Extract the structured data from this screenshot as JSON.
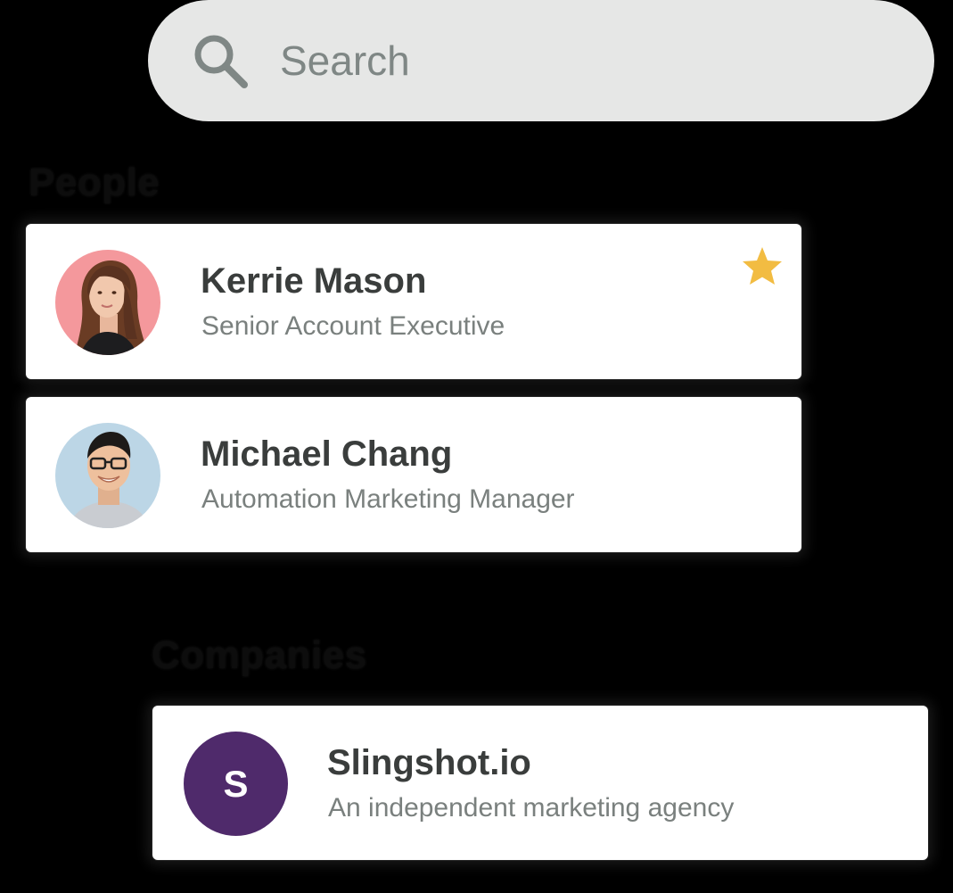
{
  "search": {
    "placeholder": "Search",
    "icon": "search-icon"
  },
  "sections": {
    "people_heading": "People",
    "companies_heading": "Companies"
  },
  "people": [
    {
      "name": "Kerrie Mason",
      "title": "Senior Account Executive",
      "avatar_bg": "#f4989c",
      "starred": true
    },
    {
      "name": "Michael Chang",
      "title": "Automation Marketing Manager",
      "avatar_bg": "#bcd6e6",
      "starred": false
    }
  ],
  "companies": [
    {
      "name": "Slingshot.io",
      "description": "An independent marketing agency",
      "logo_letter": "S",
      "logo_color": "#4f2a6b"
    }
  ],
  "colors": {
    "search_bg": "#e6e7e6",
    "star": "#f2bc42",
    "name_text": "#3a3d3c",
    "subtitle_text": "#7a807e"
  }
}
